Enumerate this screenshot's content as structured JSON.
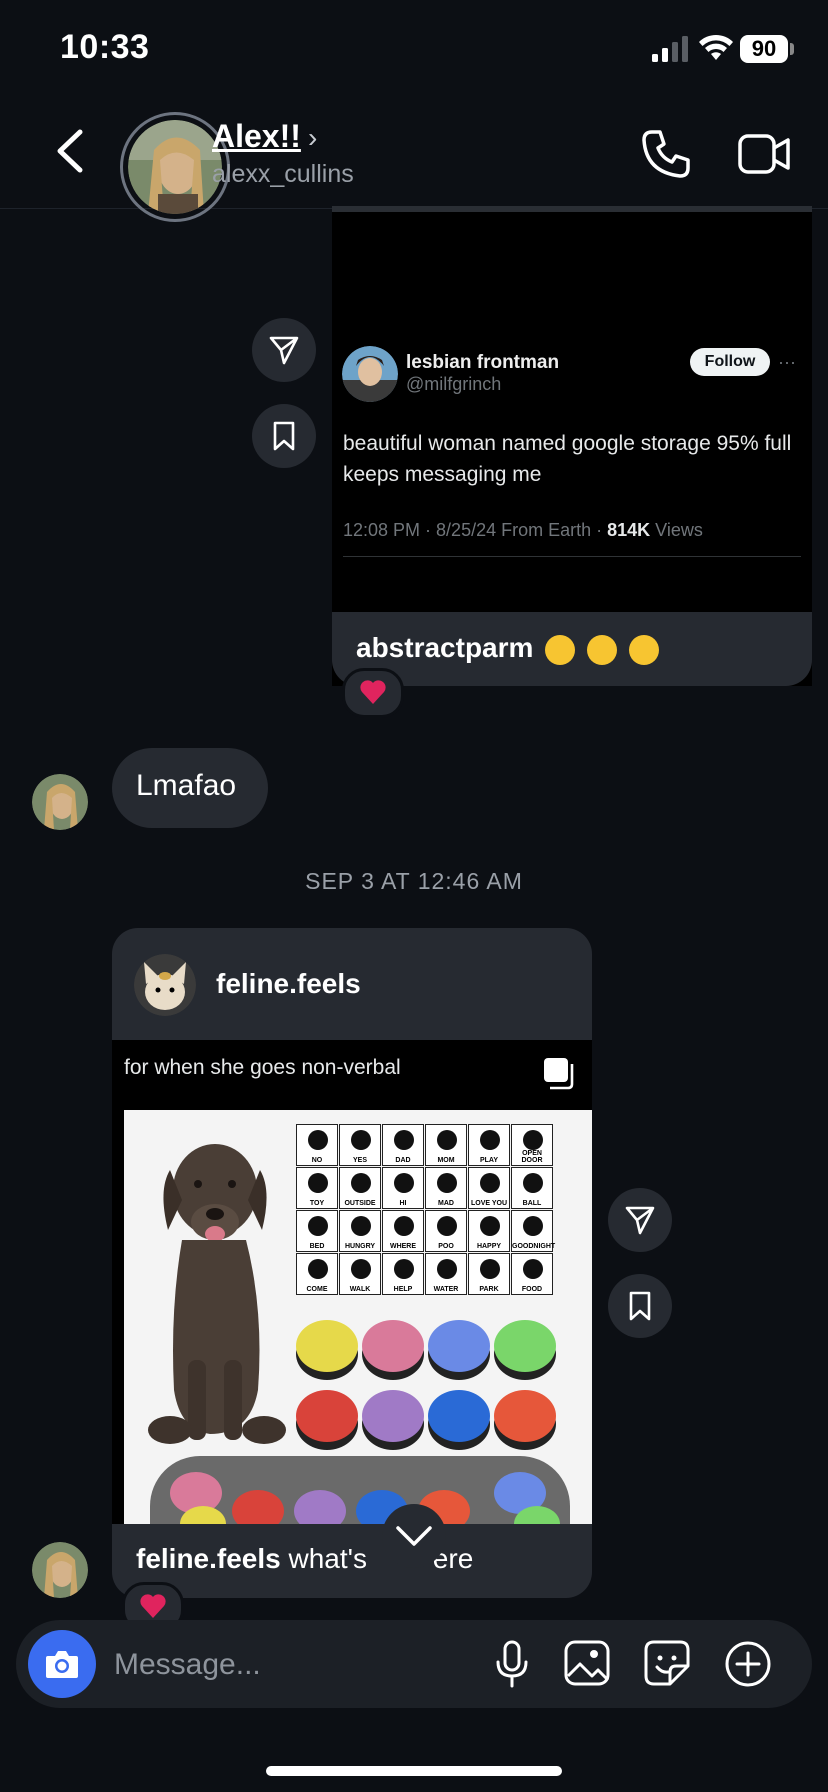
{
  "status_bar": {
    "time": "10:33",
    "battery": "90"
  },
  "header": {
    "name": "Alex!!",
    "username": "alexx_cullins"
  },
  "tweet": {
    "display_name": "lesbian frontman",
    "handle": "@milfgrinch",
    "follow_label": "Follow",
    "more": "···",
    "text": "beautiful woman named google storage 95% full keeps messaging me",
    "meta_prefix": "12:08 PM · 8/25/24 From Earth · ",
    "views_count": "814K",
    "views_label": " Views"
  },
  "shared_post_1": {
    "caption_user": "abstractparm"
  },
  "messages": {
    "lmafao": "Lmafao",
    "timestamp": "SEP 3 AT 12:46 AM"
  },
  "shared_post_2": {
    "username": "feline.feels",
    "caption": "for when she goes non-verbal",
    "caption_user": "feline.feels",
    "caption_text": " what's ",
    "caption_text_end": "ere",
    "board_labels": [
      "NO",
      "YES",
      "DAD",
      "MOM",
      "PLAY",
      "OPEN DOOR",
      "TOY",
      "OUTSIDE",
      "HI",
      "MAD",
      "LOVE YOU",
      "BALL",
      "BED",
      "HUNGRY",
      "WHERE",
      "POO",
      "HAPPY",
      "GOODNIGHT",
      "COME",
      "WALK",
      "HELP",
      "WATER",
      "PARK",
      "FOOD"
    ]
  },
  "composer": {
    "placeholder": "Message..."
  },
  "colors": {
    "accent": "#3a6cf0",
    "bubble": "#262a31",
    "background": "#0c0f14",
    "heart": "#e0245e"
  }
}
